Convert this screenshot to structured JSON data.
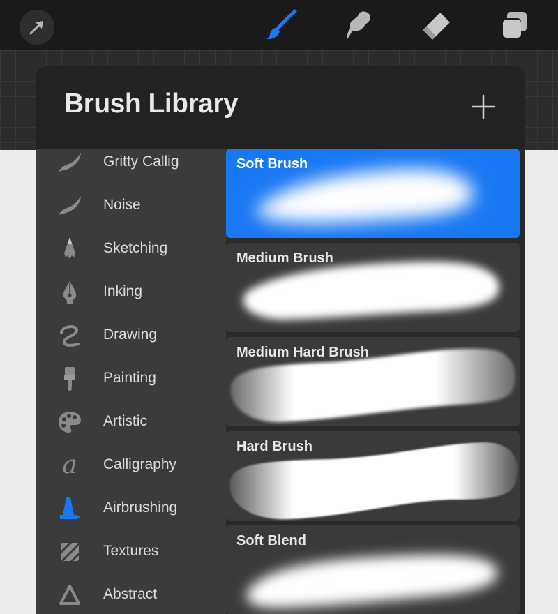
{
  "toolbar": {
    "buttons": [
      {
        "name": "modify-arrow-icon",
        "active": false
      },
      {
        "name": "brush-icon",
        "active": true
      },
      {
        "name": "smudge-icon",
        "active": false
      },
      {
        "name": "eraser-icon",
        "active": false
      },
      {
        "name": "layers-icon",
        "active": false
      }
    ],
    "accent_color": "#1877f2"
  },
  "panel": {
    "title": "Brush Library",
    "add_icon": "plus-icon"
  },
  "sidebar": {
    "items": [
      {
        "label": "Gritty Callig",
        "icon": "stroke-swoosh-icon",
        "active": false
      },
      {
        "label": "Noise",
        "icon": "stroke-swoosh-icon",
        "active": false
      },
      {
        "label": "Sketching",
        "icon": "pencil-tip-icon",
        "active": false
      },
      {
        "label": "Inking",
        "icon": "pen-nib-icon",
        "active": false
      },
      {
        "label": "Drawing",
        "icon": "squiggle-icon",
        "active": false
      },
      {
        "label": "Painting",
        "icon": "paint-brush-icon",
        "active": false
      },
      {
        "label": "Artistic",
        "icon": "palette-icon",
        "active": false
      },
      {
        "label": "Calligraphy",
        "icon": "script-a-icon",
        "active": false
      },
      {
        "label": "Airbrushing",
        "icon": "airbrush-icon",
        "active": true
      },
      {
        "label": "Textures",
        "icon": "textures-icon",
        "active": false
      },
      {
        "label": "Abstract",
        "icon": "triangle-icon",
        "active": false
      }
    ]
  },
  "brushes": [
    {
      "name": "Soft Brush",
      "selected": true
    },
    {
      "name": "Medium Brush",
      "selected": false
    },
    {
      "name": "Medium Hard Brush",
      "selected": false
    },
    {
      "name": "Hard Brush",
      "selected": false
    },
    {
      "name": "Soft Blend",
      "selected": false
    }
  ]
}
